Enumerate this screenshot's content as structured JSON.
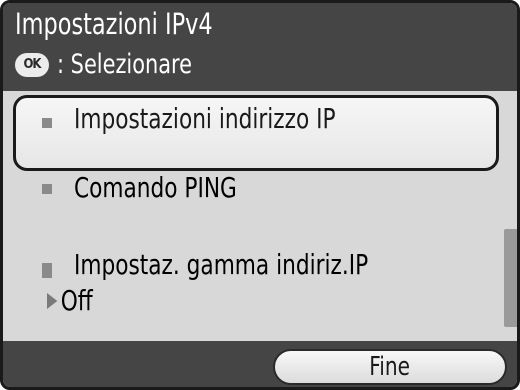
{
  "header": {
    "title": "Impostazioni IPv4",
    "hint_icon": "OK",
    "hint_text": ": Selezionare"
  },
  "menu": {
    "items": [
      {
        "label": "Impostazioni indirizzo IP",
        "selected": true
      },
      {
        "label": "Comando PING",
        "selected": false
      },
      {
        "label": "Impostaz. gamma indiriz.IP",
        "value": "Off",
        "selected": false
      }
    ]
  },
  "footer": {
    "done_label": "Fine"
  }
}
